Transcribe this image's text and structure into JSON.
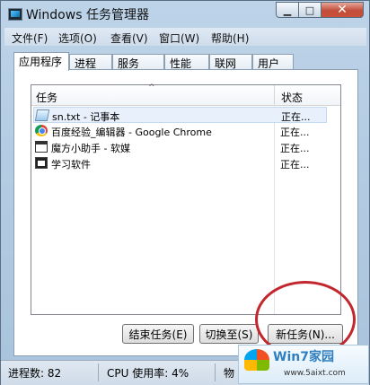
{
  "window": {
    "title": "Windows 任务管理器",
    "minimize_icon": "minimize-icon",
    "maximize_icon": "maximize-icon",
    "close_icon": "close-icon",
    "min_glyph": "▁",
    "max_glyph": "□",
    "close_glyph": "✕"
  },
  "menu": {
    "items": [
      "文件(F)",
      "选项(O)",
      "查看(V)",
      "窗口(W)",
      "帮助(H)"
    ]
  },
  "tabs": [
    "应用程序",
    "进程",
    "服务",
    "性能",
    "联网",
    "用户"
  ],
  "active_tab": "应用程序",
  "table": {
    "columns": [
      "任务",
      "状态"
    ],
    "sort_glyph": "^",
    "rows": [
      {
        "icon": "notepad-icon",
        "name": "sn.txt - 记事本",
        "status": "正在..."
      },
      {
        "icon": "chrome-icon",
        "name": "百度经验_编辑器 - Google Chrome",
        "status": "正在..."
      },
      {
        "icon": "window-icon",
        "name": "魔方小助手 - 软媒",
        "status": "正在..."
      },
      {
        "icon": "app-icon",
        "name": "学习软件",
        "status": "正在..."
      }
    ]
  },
  "buttons": {
    "end_task": "结束任务(E)",
    "switch_to": "切换至(S)",
    "new_task": "新任务(N)..."
  },
  "statusbar": {
    "processes": "进程数: 82",
    "cpu": "CPU 使用率: 4%",
    "memory": "物"
  },
  "watermark": {
    "title": "Win7家园",
    "url": "www.5aixt.com"
  },
  "colors": {
    "accent": "#3c7fb1",
    "close_red": "#c24d3a",
    "annotation_circle": "#c2272d"
  }
}
